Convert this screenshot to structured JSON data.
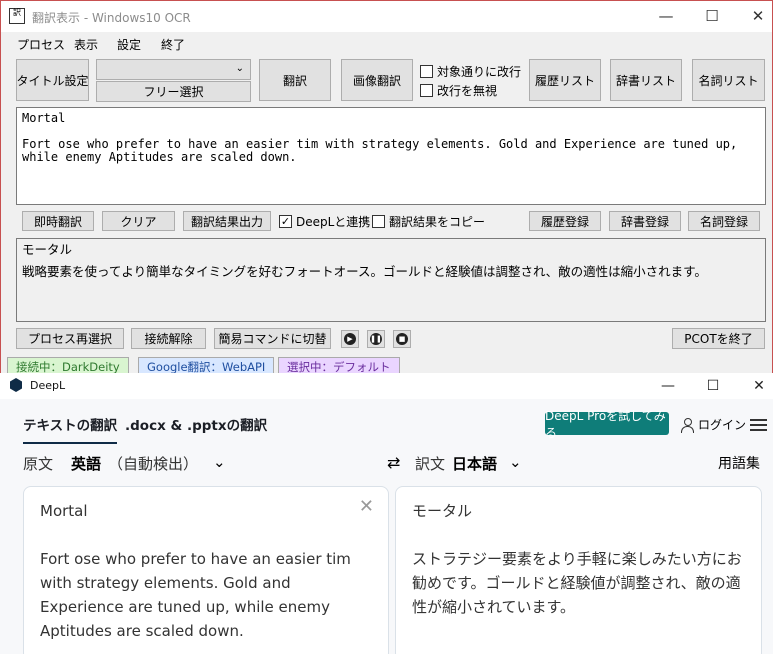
{
  "ocr": {
    "title": "翻訳表示 - Windows10 OCR",
    "app_icon_text": "訳",
    "menu": [
      "プロセス",
      "表示",
      "設定",
      "終了"
    ],
    "toolbar": {
      "title_setting": "タイトル設定",
      "combo_value": "",
      "free_select": "フリー選択",
      "translate": "翻訳",
      "image_translate": "画像翻訳",
      "check_linebreak": "対象通りに改行",
      "check_ignore_linebreak": "改行を無視",
      "history_list": "履歴リスト",
      "dict_list": "辞書リスト",
      "noun_list": "名詞リスト"
    },
    "source_text": {
      "line1": "Mortal",
      "line2": "Fort ose who prefer to have an easier tim with strategy elements. Gold and Experience are tuned up, while enemy Aptitudes are scaled down."
    },
    "mid_toolbar": {
      "instant": "即時翻訳",
      "clear": "クリア",
      "output": "翻訳結果出力",
      "deepl_link": "DeepLと連携",
      "copy_result": "翻訳結果をコピー",
      "history_reg": "履歴登録",
      "dict_reg": "辞書登録",
      "noun_reg": "名詞登録"
    },
    "result_text": {
      "line1": "モータル",
      "line2": "戦略要素を使ってより簡単なタイミングを好むフォートオース。ゴールドと経験値は調整され、敵の適性は縮小されます。"
    },
    "bottom_toolbar": {
      "reselect": "プロセス再選択",
      "disconnect": "接続解除",
      "simple_cmd": "簡易コマンドに切替",
      "exit": "PCOTを終了"
    },
    "status_tabs": [
      "接続中：DarkDeity",
      "Google翻訳：WebAPI",
      "選択中：デフォルト"
    ]
  },
  "deepl": {
    "title": "DeepL",
    "tabs": [
      "テキストの翻訳",
      ".docx & .pptxの翻訳"
    ],
    "pro_button": "DeepL Proを試してみる",
    "login": "ログイン",
    "source_lang_prefix": "原文",
    "source_lang": "英語",
    "source_lang_suffix": "（自動検出）",
    "target_lang_prefix": "訳文",
    "target_lang": "日本語",
    "glossary": "用語集",
    "source": {
      "p1": "Mortal",
      "p2": "Fort ose who prefer to have an easier tim with strategy elements. Gold and Experience are tuned up, while enemy Aptitudes are scaled down."
    },
    "target": {
      "p1": "モータル",
      "p2": "ストラテジー要素をより手軽に楽しみたい方にお勧めです。ゴールドと経験値が調整され、敵の適性が縮小されています。"
    }
  },
  "colors": {
    "accent": "#0f7d79",
    "brand": "#0f2b46",
    "tab_connected": "#d9f5d0",
    "tab_google": "#d8e7ff",
    "tab_selected": "#ead5ff"
  }
}
